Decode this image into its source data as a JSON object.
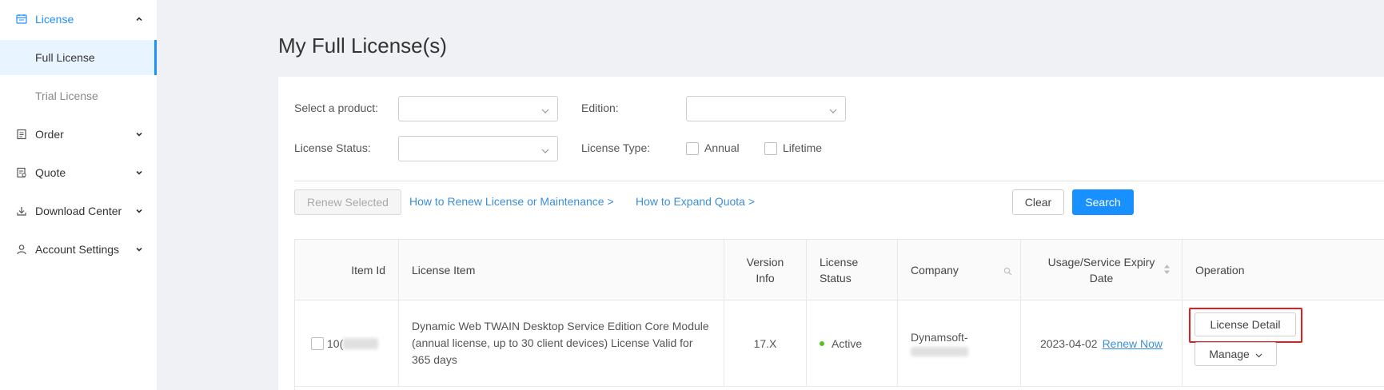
{
  "sidebar": {
    "license": {
      "label": "License",
      "icon": "license-icon"
    },
    "sub_items": [
      {
        "label": "Full License",
        "active": true
      },
      {
        "label": "Trial License",
        "active": false
      }
    ],
    "items": [
      {
        "label": "Order",
        "icon": "order-icon"
      },
      {
        "label": "Quote",
        "icon": "quote-icon"
      },
      {
        "label": "Download Center",
        "icon": "download-icon"
      },
      {
        "label": "Account Settings",
        "icon": "user-icon"
      }
    ]
  },
  "page": {
    "title": "My Full License(s)"
  },
  "filters": {
    "product_label": "Select a product:",
    "edition_label": "Edition:",
    "status_label": "License Status:",
    "type_label": "License Type:",
    "type_options": [
      "Annual",
      "Lifetime"
    ]
  },
  "actions": {
    "renew_selected": "Renew Selected",
    "how_to_renew": "How to Renew License or Maintenance >",
    "how_to_expand": "How to Expand Quota >",
    "clear": "Clear",
    "search": "Search"
  },
  "table": {
    "headers": {
      "item_id": "Item Id",
      "license_item": "License Item",
      "version_info": "Version Info",
      "license_status": "License Status",
      "company": "Company",
      "usage_expiry": "Usage/Service Expiry Date",
      "operation": "Operation"
    },
    "rows": [
      {
        "item_id_prefix": "10(",
        "license_item": "Dynamic Web TWAIN Desktop Service Edition Core Module (annual license, up to 30 client devices) License Valid for 365 days",
        "version_info": "17.X",
        "license_status": "Active",
        "company": "Dynamsoft-",
        "expiry_date": "2023-04-02",
        "renew_now": "Renew Now",
        "license_detail": "License Detail",
        "manage": "Manage"
      }
    ]
  },
  "colors": {
    "accent": "#1890ff",
    "link": "#3b8fd8",
    "active_status": "#52c41a",
    "highlight": "#e02020"
  }
}
